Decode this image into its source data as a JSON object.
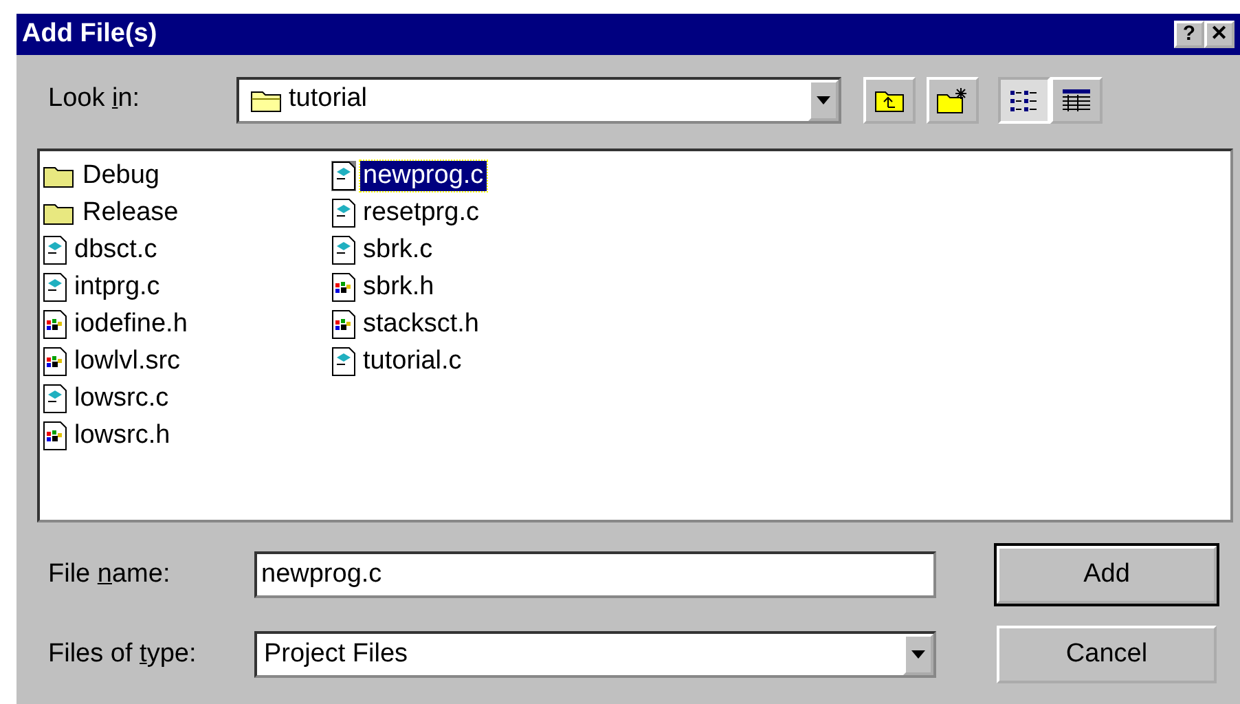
{
  "window": {
    "title": "Add File(s)",
    "buttons": [
      {
        "kind": "help",
        "label": "?"
      },
      {
        "kind": "close",
        "label": "✕"
      }
    ]
  },
  "look_in": {
    "label_before": "Look ",
    "accel": "i",
    "label_after": "n:",
    "value": "tutorial"
  },
  "toolbar": [
    {
      "kind": "up-folder",
      "selected": false
    },
    {
      "kind": "new-folder",
      "selected": false
    },
    {
      "kind": "list-view",
      "selected": true
    },
    {
      "kind": "details-view",
      "selected": false
    }
  ],
  "files": [
    {
      "name": "Debug",
      "kind": "folder",
      "selected": false
    },
    {
      "name": "Release",
      "kind": "folder",
      "selected": false
    },
    {
      "name": "dbsct.c",
      "kind": "source",
      "selected": false
    },
    {
      "name": "intprg.c",
      "kind": "source",
      "selected": false
    },
    {
      "name": "iodefine.h",
      "kind": "header",
      "selected": false
    },
    {
      "name": "lowlvl.src",
      "kind": "header",
      "selected": false
    },
    {
      "name": "lowsrc.c",
      "kind": "source",
      "selected": false
    },
    {
      "name": "lowsrc.h",
      "kind": "header",
      "selected": false
    },
    {
      "name": "newprog.c",
      "kind": "source",
      "selected": true
    },
    {
      "name": "resetprg.c",
      "kind": "source",
      "selected": false
    },
    {
      "name": "sbrk.c",
      "kind": "source",
      "selected": false
    },
    {
      "name": "sbrk.h",
      "kind": "header",
      "selected": false
    },
    {
      "name": "stacksct.h",
      "kind": "header",
      "selected": false
    },
    {
      "name": "tutorial.c",
      "kind": "source",
      "selected": false
    }
  ],
  "file_name": {
    "label_before": "File ",
    "accel": "n",
    "label_after": "ame:",
    "value": "newprog.c"
  },
  "file_type": {
    "label_before": "Files of ",
    "accel": "t",
    "label_after": "ype:",
    "value": "Project Files"
  },
  "buttons": [
    {
      "label": "Add",
      "default": true
    },
    {
      "label": "Cancel",
      "default": false
    }
  ]
}
